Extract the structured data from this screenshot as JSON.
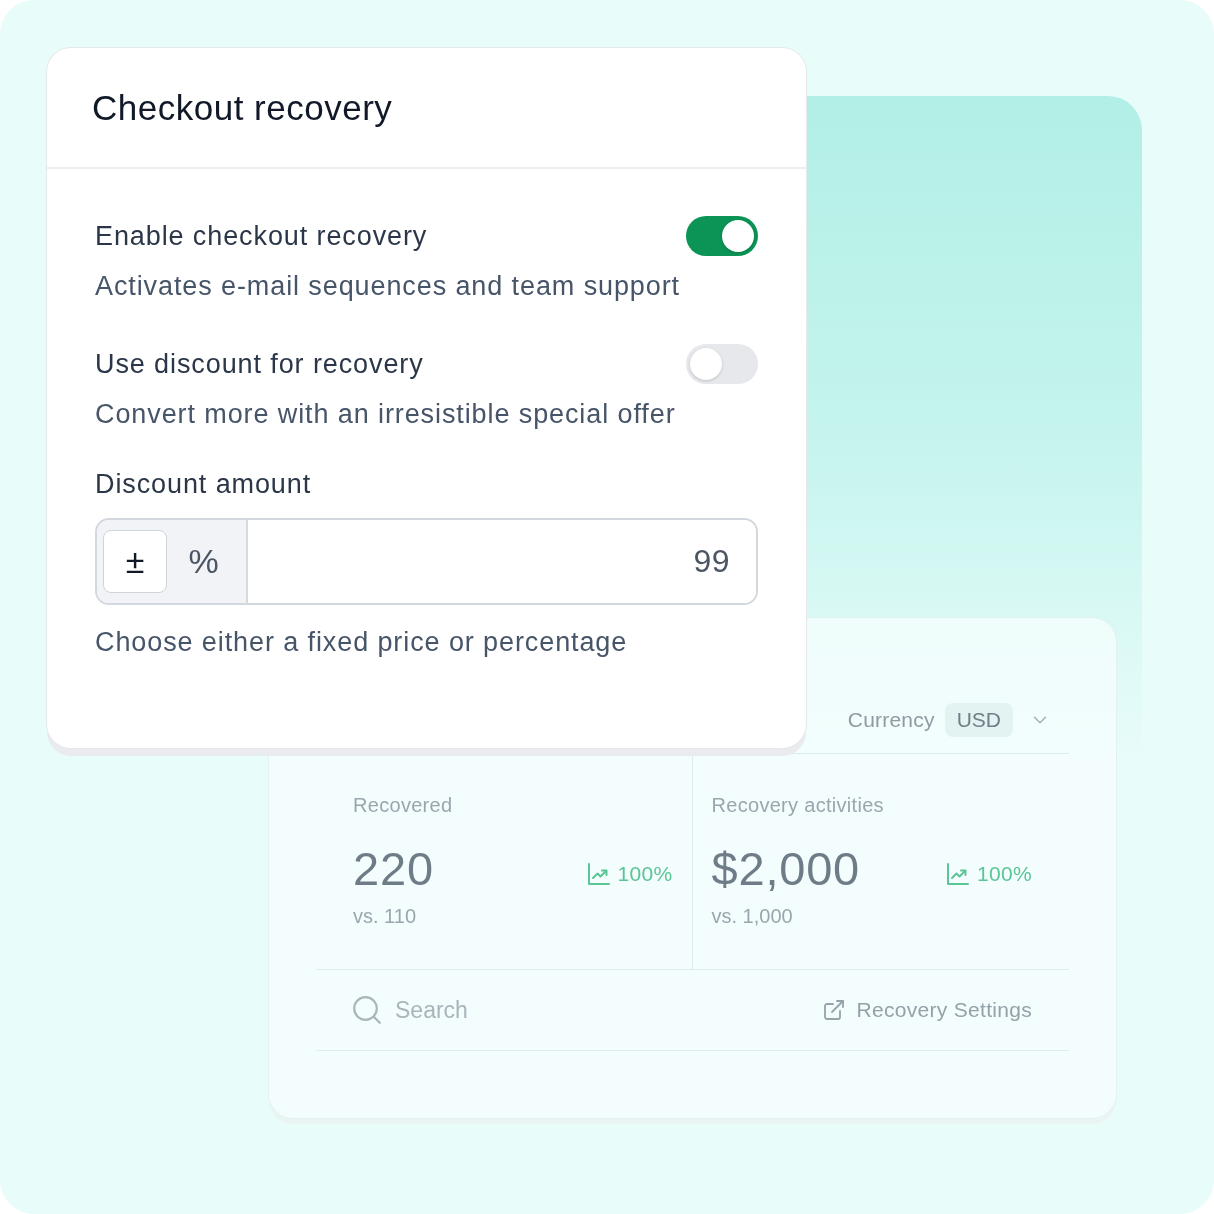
{
  "settings_card": {
    "title": "Checkout recovery",
    "options": [
      {
        "label": "Enable checkout recovery",
        "description": "Activates e-mail sequences and team support",
        "on": true
      },
      {
        "label": "Use discount for recovery",
        "description": "Convert more with an irresistible special offer",
        "on": false
      }
    ],
    "discount": {
      "label": "Discount amount",
      "modes": [
        {
          "label": "±",
          "selected": true
        },
        {
          "label": "%",
          "selected": false
        }
      ],
      "value": "99",
      "helper": "Choose either a fixed price or percentage"
    }
  },
  "stats_card": {
    "currency": {
      "label": "Currency",
      "value": "USD"
    },
    "metrics": [
      {
        "label": "Recovered",
        "value": "220",
        "change": "100%",
        "comparison": "vs. 110"
      },
      {
        "label": "Recovery activities",
        "value": "$2,000",
        "change": "100%",
        "comparison": "vs. 1,000"
      }
    ],
    "search": {
      "placeholder": "Search"
    },
    "link": "Recovery Settings"
  }
}
